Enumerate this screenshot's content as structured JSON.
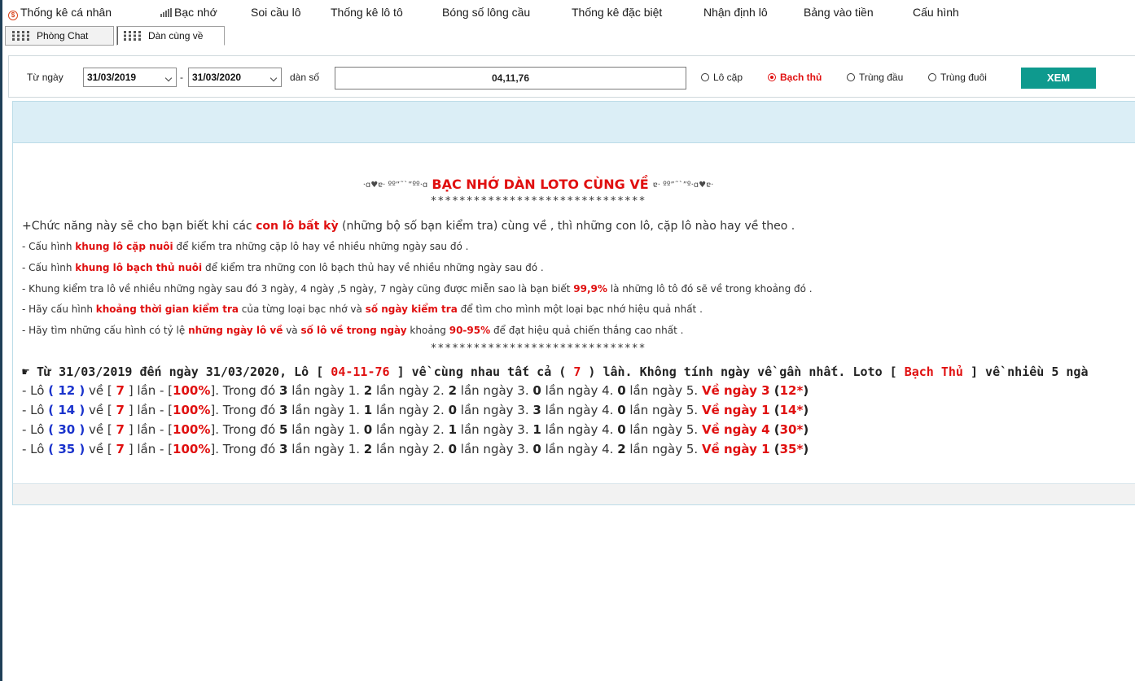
{
  "menu": {
    "items": [
      {
        "label": "Thống kê cá nhân"
      },
      {
        "label": "Bạc nhớ"
      },
      {
        "label": "Soi cầu lô"
      },
      {
        "label": "Thống kê lô tô"
      },
      {
        "label": "Bóng số lông cầu"
      },
      {
        "label": "Thống kê đặc biệt"
      },
      {
        "label": "Nhận định lô"
      },
      {
        "label": "Bảng vào tiền"
      },
      {
        "label": "Cấu hình"
      }
    ]
  },
  "tabs": [
    {
      "label": "Phòng Chat"
    },
    {
      "label": "Dàn cùng về"
    }
  ],
  "filter": {
    "from_label": "Từ ngày",
    "from_date": "31/03/2019",
    "sep": "-",
    "to_date": "31/03/2020",
    "dan_label": "dàn số",
    "dan_value": "04,11,76",
    "options": [
      {
        "label": "Lô cặp",
        "selected": false
      },
      {
        "label": "Bạch thủ",
        "selected": true
      },
      {
        "label": "Trùng đầu",
        "selected": false
      },
      {
        "label": "Trùng đuôi",
        "selected": false
      }
    ],
    "submit": "XEM",
    "accent_color": "#0e9a8e"
  },
  "content": {
    "title_deco_left": "·ɑ♥ɐ· ºº”˜`”ºº·ɑ",
    "title": "BẠC NHỚ DÀN LOTO CÙNG VỀ",
    "title_deco_right": "ɐ· ºº”˜`”º·ɑ♥ɐ·",
    "stars": "******************************",
    "intro": {
      "l1_a": "+Chức năng này sẽ cho bạn biết khi các ",
      "l1_b": "con lô bất kỳ",
      "l1_c": " (những bộ số bạn kiểm tra) cùng về , thì những con lô, cặp lô nào hay về theo .",
      "l2_a": "- Cấu hình ",
      "l2_b": "khung lô cặp nuôi",
      "l2_c": " để kiểm tra những cặp lô hay về nhiều những ngày sau đó .",
      "l3_a": "- Cấu hình ",
      "l3_b": "khung lô bạch thủ nuôi",
      "l3_c": " để kiểm tra những con lô bạch thủ hay về nhiều những ngày sau đó .",
      "l4_a": "- Khung kiểm tra lô về nhiều những ngày sau đó 3 ngày, 4 ngày ,5 ngày, 7 ngày cũng được miễn sao là bạn biết ",
      "l4_b": "99,9%",
      "l4_c": " là những lô tô đó sẽ về trong khoảng đó .",
      "l5_a": "- Hãy cấu hình ",
      "l5_b": "khoảng thời gian kiểm tra",
      "l5_c": " của từng loại bạc nhớ và ",
      "l5_d": "số ngày kiểm tra",
      "l5_e": " để tìm cho mình một loại bạc nhớ hiệu quả nhất .",
      "l6_a": "- Hãy tìm những cấu hình có tỷ lệ ",
      "l6_b": "những ngày lô về",
      "l6_c": " và ",
      "l6_d": "số lô về trong ngày",
      "l6_e": " khoảng ",
      "l6_f": "90-95%",
      "l6_g": " để đạt hiệu quả chiến thắng cao nhất ."
    },
    "summary": {
      "a": "☛ Từ 31/03/2019 đến ngày 31/03/2020, Lô [ ",
      "dan": "04-11-76",
      "b": " ] về cùng nhau tất cả ( ",
      "count": "7",
      "c": " ) lần. Không tính ngày về gần nhất. Loto [ ",
      "kind": "Bạch Thủ",
      "d": " ] về nhiều 5 ngà"
    },
    "results": [
      {
        "lo": "12",
        "times": "7",
        "pct": "100%",
        "d1": "3",
        "d2": "2",
        "d3": "2",
        "d4": "0",
        "d5": "0",
        "ve_text": "Về ngày 3",
        "tag": "12*"
      },
      {
        "lo": "14",
        "times": "7",
        "pct": "100%",
        "d1": "3",
        "d2": "1",
        "d3": "0",
        "d4": "3",
        "d5": "0",
        "ve_text": "Về ngày 1",
        "tag": "14*"
      },
      {
        "lo": "30",
        "times": "7",
        "pct": "100%",
        "d1": "5",
        "d2": "0",
        "d3": "1",
        "d4": "1",
        "d5": "0",
        "ve_text": "Về ngày 4",
        "tag": "30*"
      },
      {
        "lo": "35",
        "times": "7",
        "pct": "100%",
        "d1": "3",
        "d2": "2",
        "d3": "0",
        "d4": "0",
        "d5": "2",
        "ve_text": "Về ngày 1",
        "tag": "35*"
      }
    ],
    "res_words": {
      "pre": "- Lô ",
      "open_paren": "( ",
      "close_paren": " )",
      "ve": " về [ ",
      "lan_open": " ] lần - [",
      "lan_close": "]. Trong đó ",
      "n1": " lần ngày 1. ",
      "n2": " lần ngày 2. ",
      "n3": " lần ngày 3. ",
      "n4": " lần ngày 4. ",
      "n5": " lần ngày 5. ",
      "tag_open": " (",
      "tag_close": ")"
    }
  }
}
